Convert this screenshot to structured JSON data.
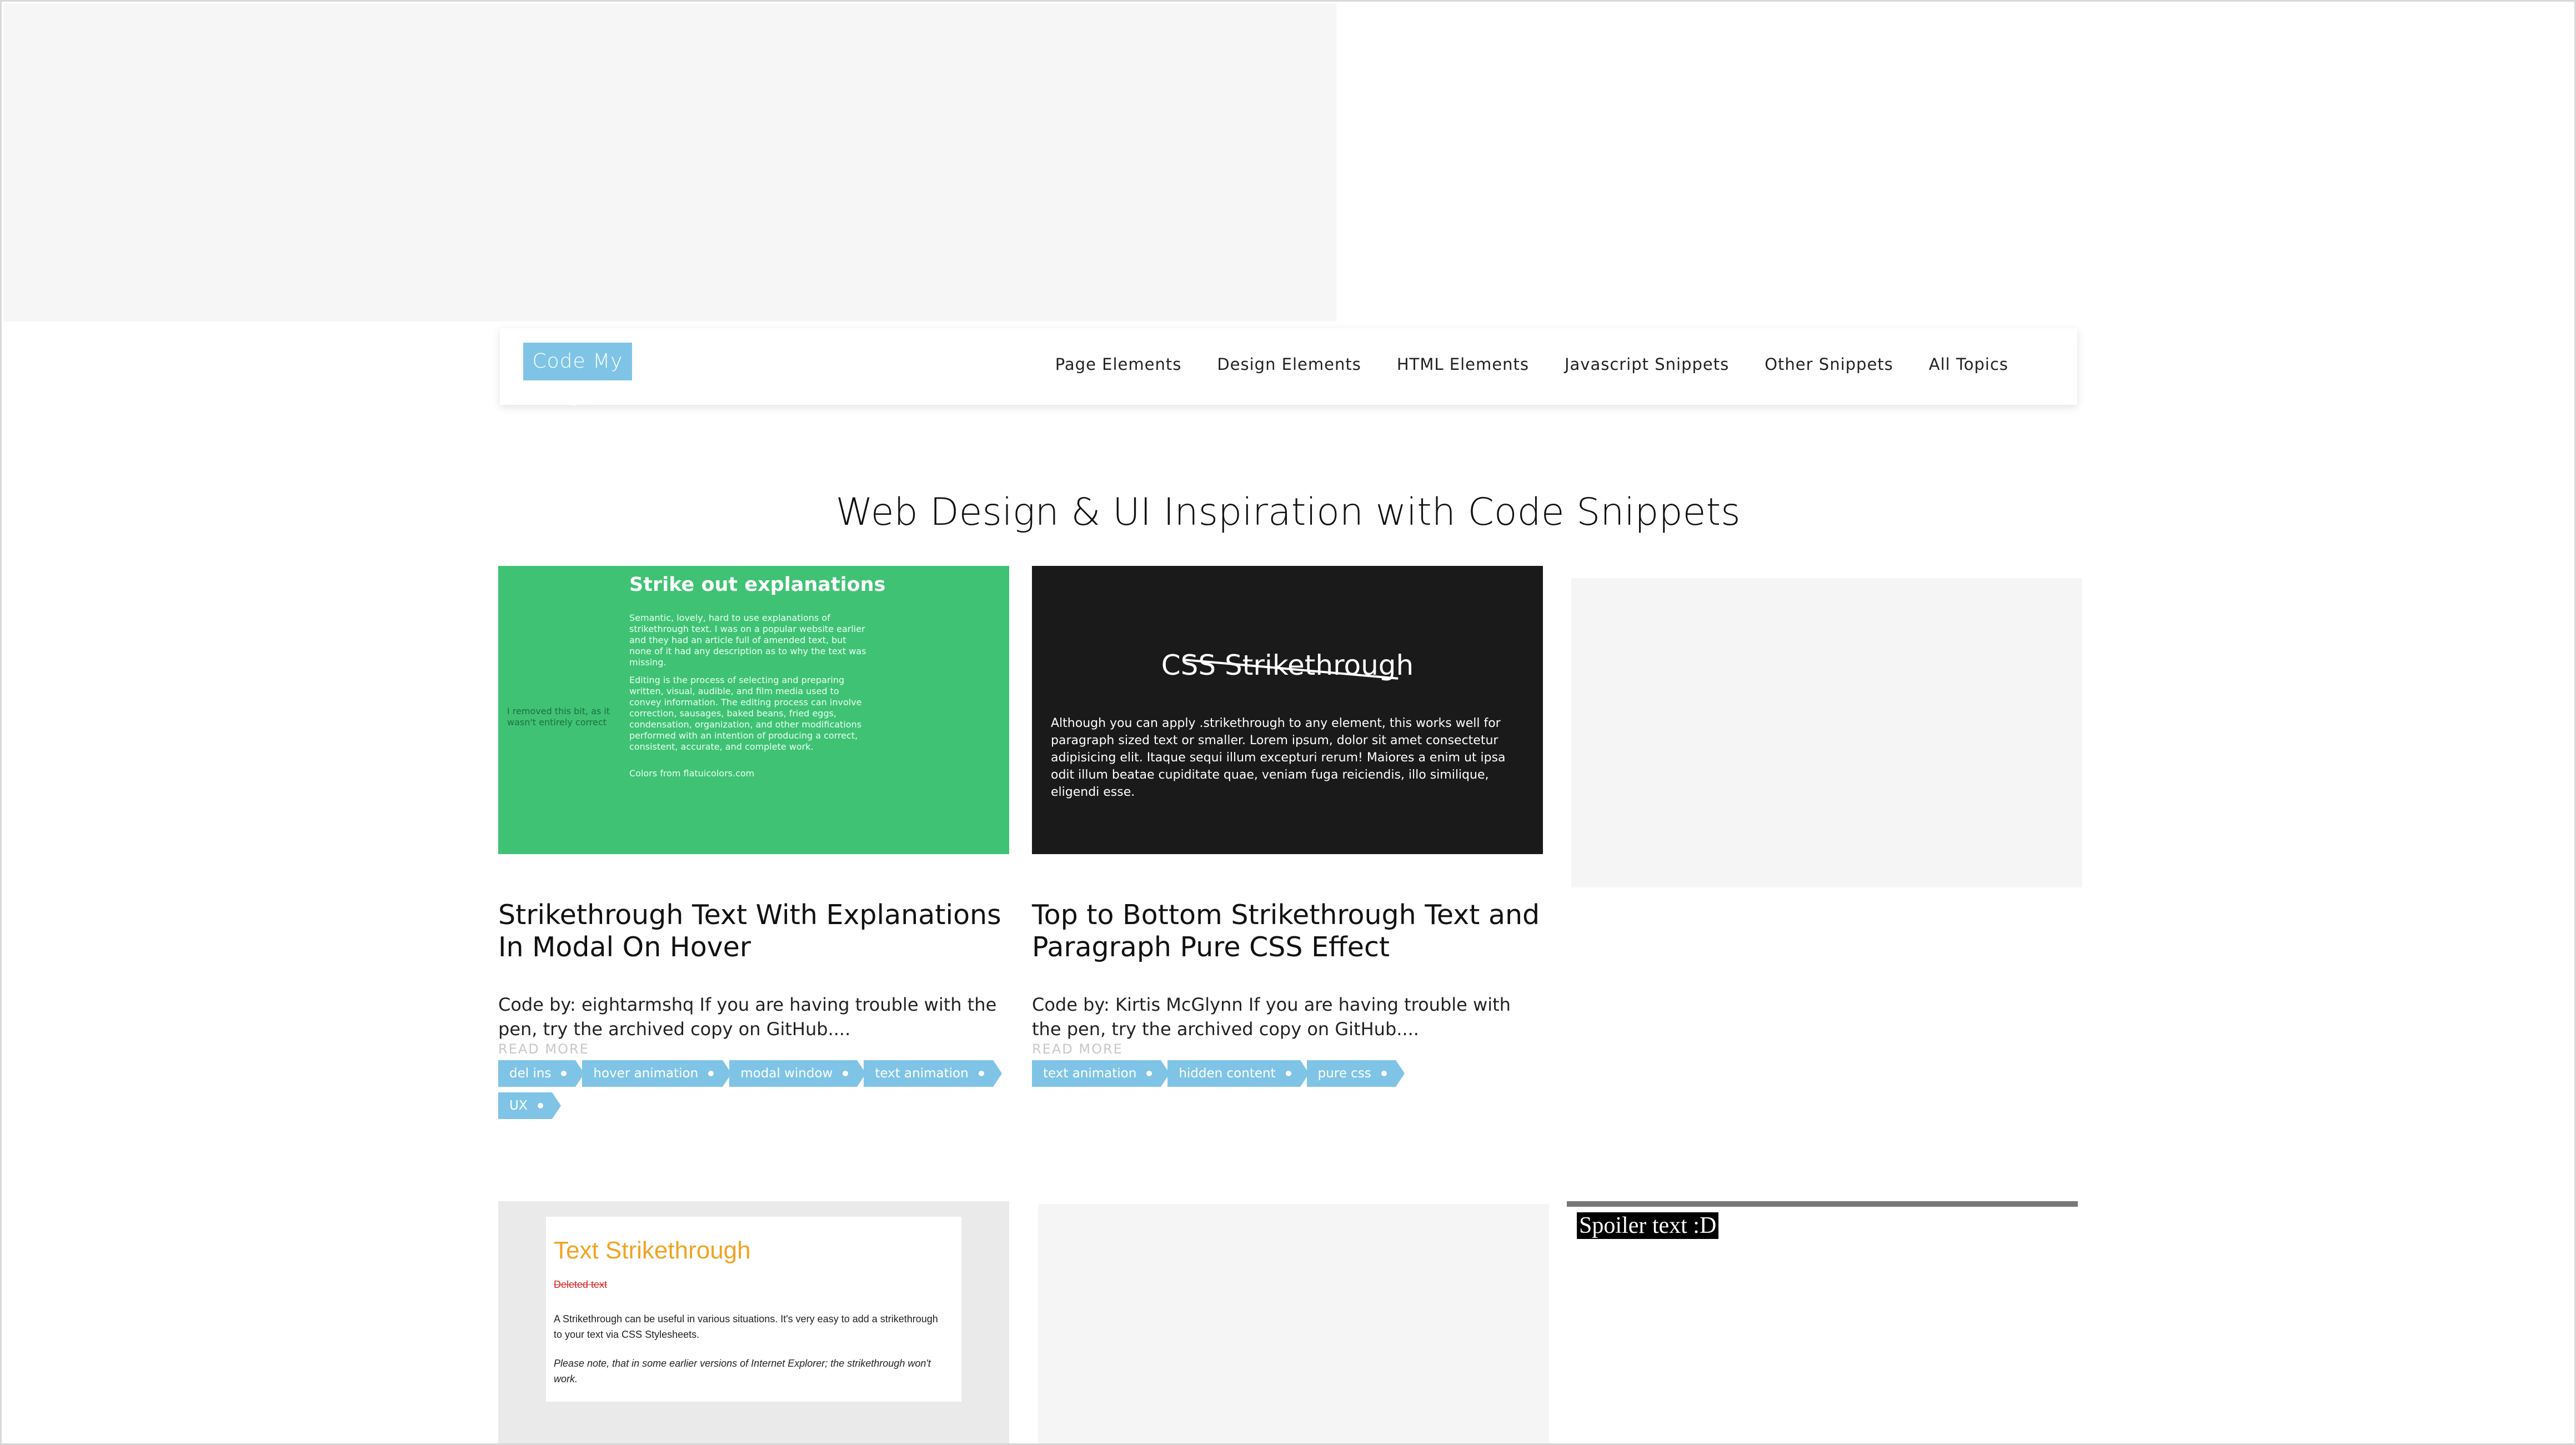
{
  "header": {
    "logo": "Code My UI",
    "menu": [
      "Page Elements",
      "Design Elements",
      "HTML Elements",
      "Javascript Snippets",
      "Other Snippets",
      "All Topics"
    ]
  },
  "headline": "Web Design & UI Inspiration with Code Snippets",
  "cards": [
    {
      "thumb": {
        "heading": "Strike out explanations",
        "p1": "Semantic, lovely, hard to use explanations of strikethrough text. I was on a popular website earlier and they had an article full of amended text, but none of it had any description as to why the text was missing.",
        "p2": "Editing is the process of selecting and preparing written, visual, audible, and film media used to convey information. The editing process can involve correction, sausages, baked beans, fried eggs, condensation, organization, and other modifications performed with an intention of producing a correct, consistent, accurate, and complete work.",
        "p3": "Colors from flatuicolors.com",
        "side": "I removed this bit, as it wasn't entirely correct"
      },
      "title": "Strikethrough Text With Explanations In Modal On Hover",
      "excerpt": "Code by: eightarmshq If you are having trouble with the pen, try the archived copy on GitHub....",
      "read_more": "READ MORE",
      "tags": [
        "del ins",
        "hover animation",
        "modal window",
        "text animation",
        "UX"
      ]
    },
    {
      "thumb": {
        "heading": "CSS Strikethrough",
        "p": "Although you can apply .strikethrough to any element, this works well for paragraph sized text or smaller. Lorem ipsum, dolor sit amet consectetur adipisicing elit. Itaque sequi illum excepturi rerum! Maiores a enim ut ipsa odit illum beatae cupiditate quae, veniam fuga reiciendis, illo similique, eligendi esse."
      },
      "title": "Top to Bottom Strikethrough Text and Paragraph Pure CSS Effect",
      "excerpt": "Code by: Kirtis McGlynn If you are having trouble with the pen, try the archived copy on GitHub....",
      "read_more": "READ MORE",
      "tags": [
        "text animation",
        "hidden content",
        "pure css"
      ]
    }
  ],
  "bottom": {
    "text_strike": {
      "heading": "Text Strikethrough",
      "deleted": "Deleted text",
      "p1": "A Strikethrough can be useful in various situations. It's very easy to add a strikethrough to your text via CSS Stylesheets.",
      "p2": "Please note, that in some earlier versions of Internet Explorer; the strikethrough won't work."
    },
    "spoiler": "Spoiler text :D"
  }
}
